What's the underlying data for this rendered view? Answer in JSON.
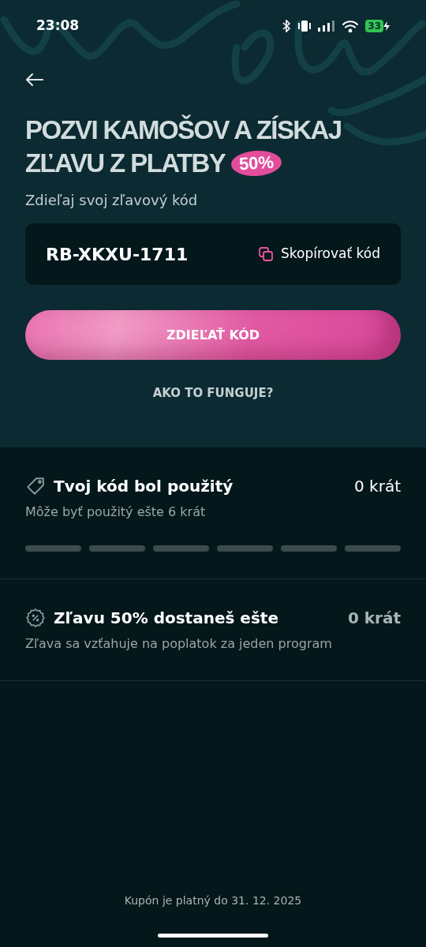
{
  "status_bar": {
    "time": "23:08",
    "battery": "33"
  },
  "heading": {
    "line_1": "POZVI KAMOŠOV A ZÍSKAJ",
    "line_2": "ZĽAVU Z PLATBY",
    "badge": "50%"
  },
  "subtitle": "Zdieľaj svoj zľavový kód",
  "code_box": {
    "code": "RB-XKXU-1711",
    "copy_label": "Skopírovať kód"
  },
  "share_button": "ZDIEĽAŤ KÓD",
  "how_link": "AKO TO FUNGUJE?",
  "stats": [
    {
      "kind": "usage",
      "title": "Tvoj kód bol použitý",
      "count": "0 krát",
      "dimmed": false,
      "note": "Môže byť použitý ešte 6 krát",
      "segments": [
        {
          "filled": false
        },
        {
          "filled": false
        },
        {
          "filled": false
        },
        {
          "filled": false
        },
        {
          "filled": false
        },
        {
          "filled": false
        }
      ]
    },
    {
      "kind": "discount",
      "title": "Zľavu 50% dostaneš ešte",
      "count": "0 krát",
      "dimmed": true,
      "note": "Zľava sa vzťahuje na poplatok za jeden program"
    }
  ],
  "footer": "Kupón je platný do 31. 12. 2025"
}
